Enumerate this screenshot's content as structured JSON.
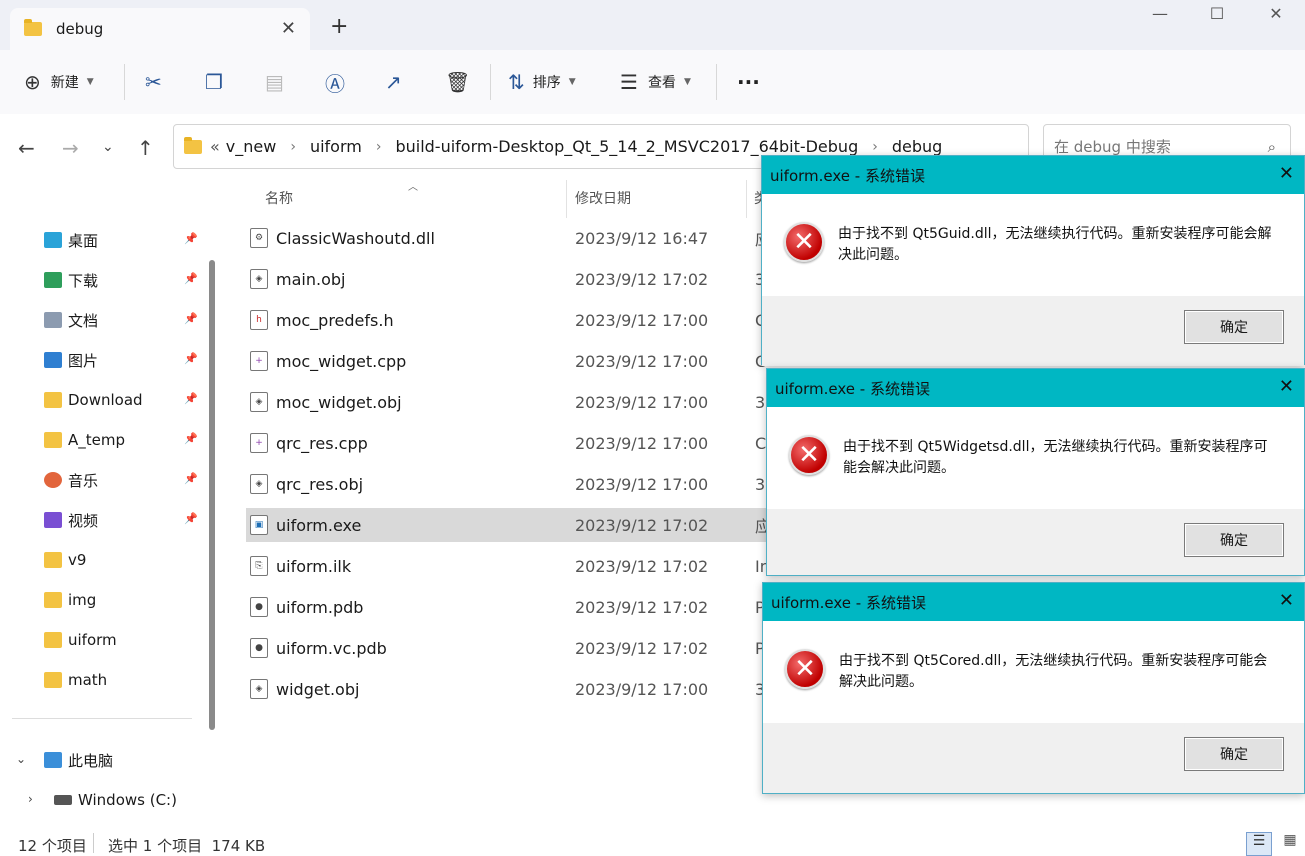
{
  "tab": {
    "title": "debug",
    "close": "✕",
    "new_tab": "+"
  },
  "window_controls": {
    "minimize": "—",
    "maximize": "☐",
    "close": "✕"
  },
  "toolbar": {
    "new_label": "新建",
    "sort_label": "排序",
    "view_label": "查看",
    "more_label": "···"
  },
  "address": {
    "overflow": "«",
    "crumbs": [
      "v_new",
      "uiform",
      "build-uiform-Desktop_Qt_5_14_2_MSVC2017_64bit-Debug",
      "debug"
    ],
    "chev": "›"
  },
  "search": {
    "placeholder": "在 debug 中搜索"
  },
  "sidebar": {
    "items": [
      {
        "label": "桌面",
        "icon": "desktop-icon",
        "pinned": true
      },
      {
        "label": "下载",
        "icon": "download-icon",
        "pinned": true
      },
      {
        "label": "文档",
        "icon": "document-icon",
        "pinned": true
      },
      {
        "label": "图片",
        "icon": "pictures-icon",
        "pinned": true
      },
      {
        "label": "Download",
        "icon": "folder-icon",
        "pinned": true
      },
      {
        "label": "A_temp",
        "icon": "folder-icon",
        "pinned": true
      },
      {
        "label": "音乐",
        "icon": "music-icon",
        "pinned": true
      },
      {
        "label": "视频",
        "icon": "video-icon",
        "pinned": true
      },
      {
        "label": "v9",
        "icon": "folder-icon",
        "pinned": false
      },
      {
        "label": "img",
        "icon": "folder-icon",
        "pinned": false
      },
      {
        "label": "uiform",
        "icon": "folder-icon",
        "pinned": false
      },
      {
        "label": "math",
        "icon": "folder-icon",
        "pinned": false
      }
    ],
    "this_pc": "此电脑",
    "drive": "Windows (C:)"
  },
  "columns": {
    "name": "名称",
    "date": "修改日期",
    "type": "类"
  },
  "files": [
    {
      "name": "ClassicWashoutd.dll",
      "date": "2023/9/12 16:47",
      "type": "应",
      "icon": "dll-icon"
    },
    {
      "name": "main.obj",
      "date": "2023/9/12 17:02",
      "type": "3",
      "icon": "obj-icon"
    },
    {
      "name": "moc_predefs.h",
      "date": "2023/9/12 17:00",
      "type": "C",
      "icon": "header-icon"
    },
    {
      "name": "moc_widget.cpp",
      "date": "2023/9/12 17:00",
      "type": "C",
      "icon": "cpp-icon"
    },
    {
      "name": "moc_widget.obj",
      "date": "2023/9/12 17:00",
      "type": "3",
      "icon": "obj-icon"
    },
    {
      "name": "qrc_res.cpp",
      "date": "2023/9/12 17:00",
      "type": "C",
      "icon": "cpp-icon"
    },
    {
      "name": "qrc_res.obj",
      "date": "2023/9/12 17:00",
      "type": "3",
      "icon": "obj-icon"
    },
    {
      "name": "uiform.exe",
      "date": "2023/9/12 17:02",
      "type": "应",
      "icon": "exe-icon",
      "selected": true
    },
    {
      "name": "uiform.ilk",
      "date": "2023/9/12 17:02",
      "type": "In",
      "icon": "ilk-icon"
    },
    {
      "name": "uiform.pdb",
      "date": "2023/9/12 17:02",
      "type": "P",
      "icon": "pdb-icon"
    },
    {
      "name": "uiform.vc.pdb",
      "date": "2023/9/12 17:02",
      "type": "P",
      "icon": "pdb-icon"
    },
    {
      "name": "widget.obj",
      "date": "2023/9/12 17:00",
      "type": "3",
      "icon": "obj-icon"
    }
  ],
  "status": {
    "count": "12 个项目",
    "selected": "选中 1 个项目  174 KB"
  },
  "dialogs": [
    {
      "title": "uiform.exe - 系统错误",
      "message": "由于找不到 Qt5Guid.dll，无法继续执行代码。重新安装程序可能会解决此问题。",
      "ok": "确定"
    },
    {
      "title": "uiform.exe - 系统错误",
      "message": "由于找不到 Qt5Widgetsd.dll，无法继续执行代码。重新安装程序可能会解决此问题。",
      "ok": "确定"
    },
    {
      "title": "uiform.exe - 系统错误",
      "message": "由于找不到 Qt5Cored.dll，无法继续执行代码。重新安装程序可能会解决此问题。",
      "ok": "确定"
    }
  ],
  "colors": {
    "dialog_title": "#00b7c3",
    "selection": "#d9d9d9",
    "folder": "#f3c343"
  }
}
